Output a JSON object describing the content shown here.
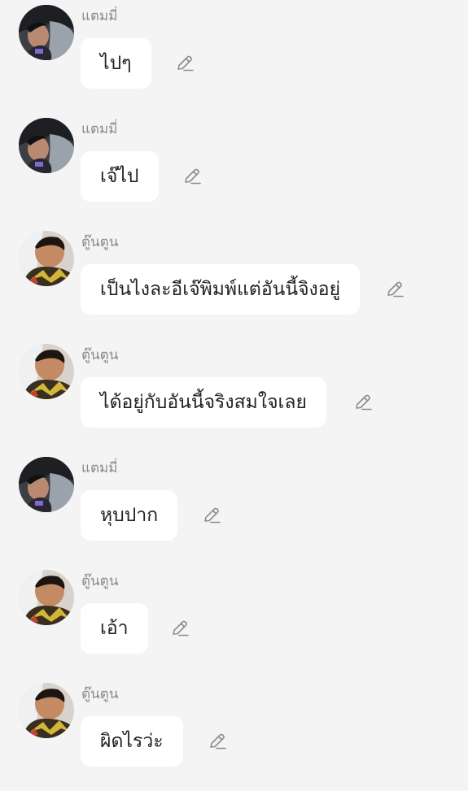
{
  "messages": [
    {
      "sender": "แตมมี่",
      "text": "ไปๆ",
      "avatar": "avatar-a"
    },
    {
      "sender": "แตมมี่",
      "text": "เจ๊ไป",
      "avatar": "avatar-a"
    },
    {
      "sender": "ตู๊นตูน",
      "text": "เป็นไงละอีเจ๊พิมพ์แต่อันนี้จิงอยู่",
      "avatar": "avatar-b"
    },
    {
      "sender": "ตู๊นตูน",
      "text": "ได้อยู่กับอันนี้จริงสมใจเลย",
      "avatar": "avatar-b"
    },
    {
      "sender": "แตมมี่",
      "text": "หุบปาก",
      "avatar": "avatar-a"
    },
    {
      "sender": "ตู๊นตูน",
      "text": "เอ้า",
      "avatar": "avatar-b"
    },
    {
      "sender": "ตู๊นตูน",
      "text": "ผิดไรว่ะ",
      "avatar": "avatar-b"
    }
  ],
  "icons": {
    "edit": "pencil-edit-icon"
  },
  "colors": {
    "background": "#f4f4f4",
    "bubble": "#ffffff",
    "sender_name": "#8a8a8a",
    "message_text": "#222222",
    "edit_icon": "#8c8c8c"
  }
}
